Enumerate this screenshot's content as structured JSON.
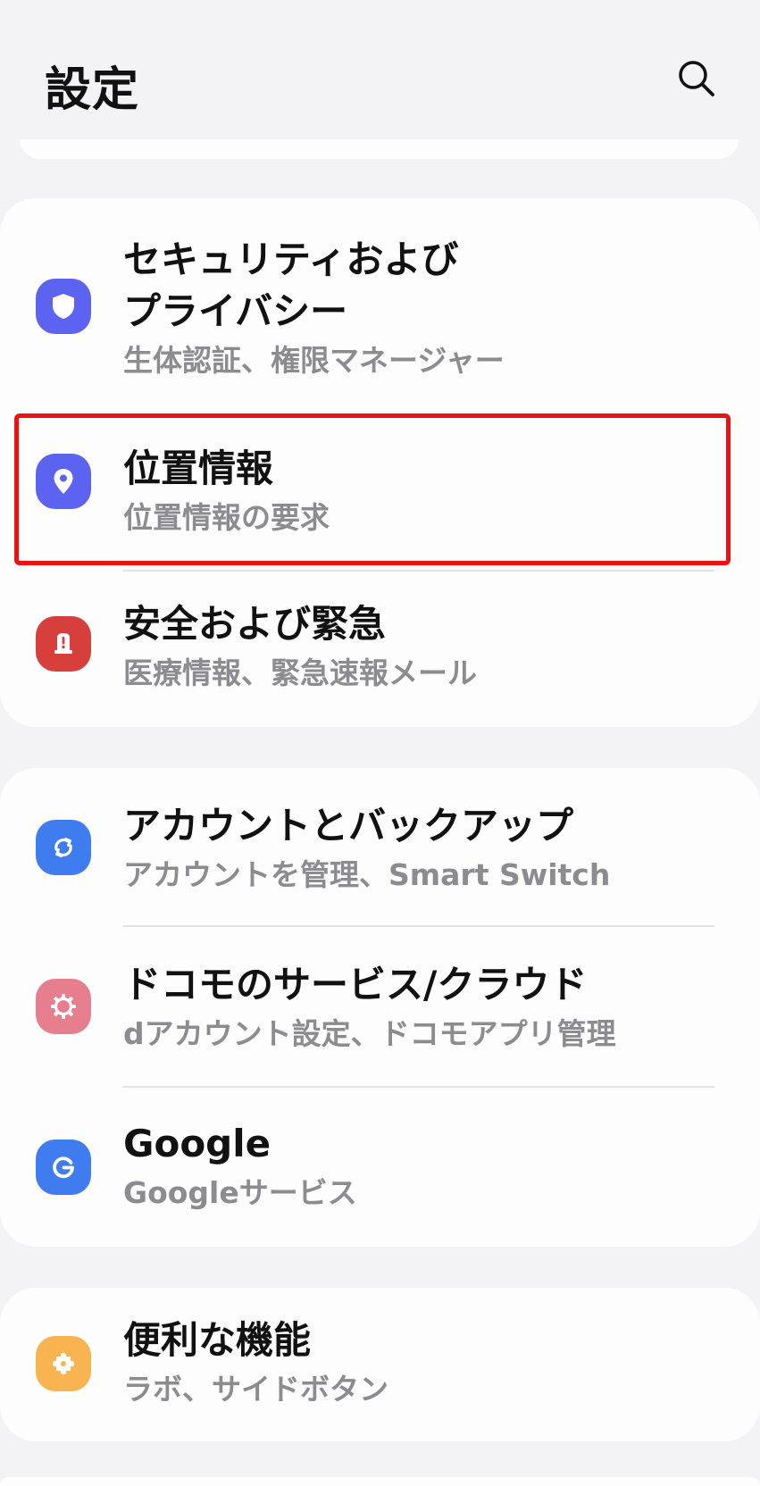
{
  "header": {
    "title": "設定"
  },
  "colors": {
    "background": "#f3f3f6",
    "card": "#fdfdfe",
    "highlight": "#ee1111",
    "security_icon": "#5b63f0",
    "location_icon": "#5b63f0",
    "safety_icon": "#d63f3b",
    "accounts_icon": "#3e7cf0",
    "docomo_icon": "#e67e8e",
    "google_icon": "#3e7cf0",
    "advanced_icon": "#f7b451"
  },
  "groups": [
    {
      "items": [
        {
          "title": "セキュリティおよび\nプライバシー",
          "subtitle": "生体認証、権限マネージャー",
          "icon": "shield-icon"
        },
        {
          "title": "位置情報",
          "subtitle": "位置情報の要求",
          "icon": "location-pin-icon",
          "highlighted": true
        },
        {
          "title": "安全および緊急",
          "subtitle": "医療情報、緊急速報メール",
          "icon": "emergency-icon"
        }
      ]
    },
    {
      "items": [
        {
          "title": "アカウントとバックアップ",
          "subtitle": "アカウントを管理、Smart Switch",
          "icon": "sync-icon"
        },
        {
          "title": "ドコモのサービス/クラウド",
          "subtitle": "dアカウント設定、ドコモアプリ管理",
          "icon": "gear-icon"
        },
        {
          "title": "Google",
          "subtitle": "Googleサービス",
          "icon": "google-icon"
        }
      ]
    },
    {
      "items": [
        {
          "title": "便利な機能",
          "subtitle": "ラボ、サイドボタン",
          "icon": "puzzle-gear-icon"
        }
      ]
    }
  ]
}
